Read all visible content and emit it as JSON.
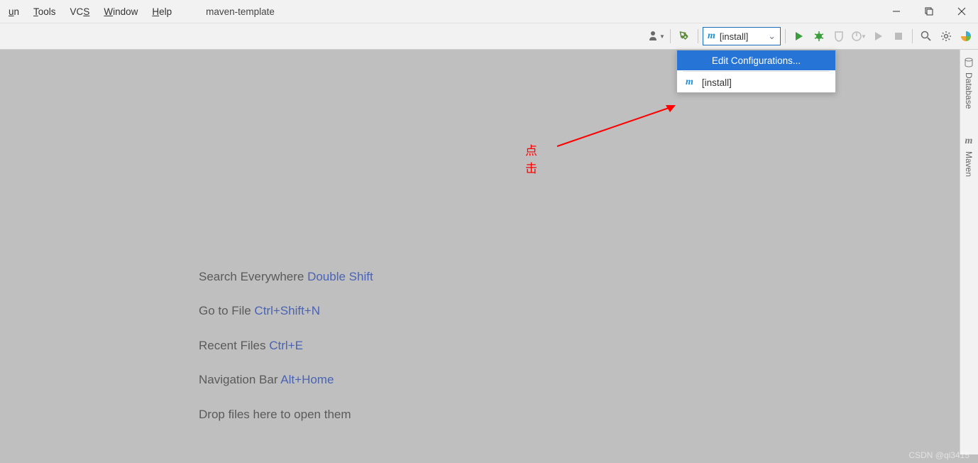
{
  "menubar": {
    "items": [
      {
        "pre": "",
        "ul": "u",
        "post": "n"
      },
      {
        "pre": "",
        "ul": "T",
        "post": "ools"
      },
      {
        "pre": "VC",
        "ul": "S",
        "post": ""
      },
      {
        "pre": "",
        "ul": "W",
        "post": "indow"
      },
      {
        "pre": "",
        "ul": "H",
        "post": "elp"
      }
    ],
    "project_name": "maven-template"
  },
  "toolbar": {
    "run_config_label": "[install]"
  },
  "dropdown": {
    "edit_label": "Edit Configurations...",
    "install_label": "[install]"
  },
  "hints": [
    {
      "text": "Search Everywhere ",
      "shortcut": "Double Shift"
    },
    {
      "text": "Go to File ",
      "shortcut": "Ctrl+Shift+N"
    },
    {
      "text": "Recent Files ",
      "shortcut": "Ctrl+E"
    },
    {
      "text": "Navigation Bar ",
      "shortcut": "Alt+Home"
    },
    {
      "text": "Drop files here to open them",
      "shortcut": ""
    }
  ],
  "right_tabs": {
    "database": "Database",
    "maven": "Maven"
  },
  "annotation": {
    "label": "点击"
  },
  "watermark": "CSDN @qi3415"
}
